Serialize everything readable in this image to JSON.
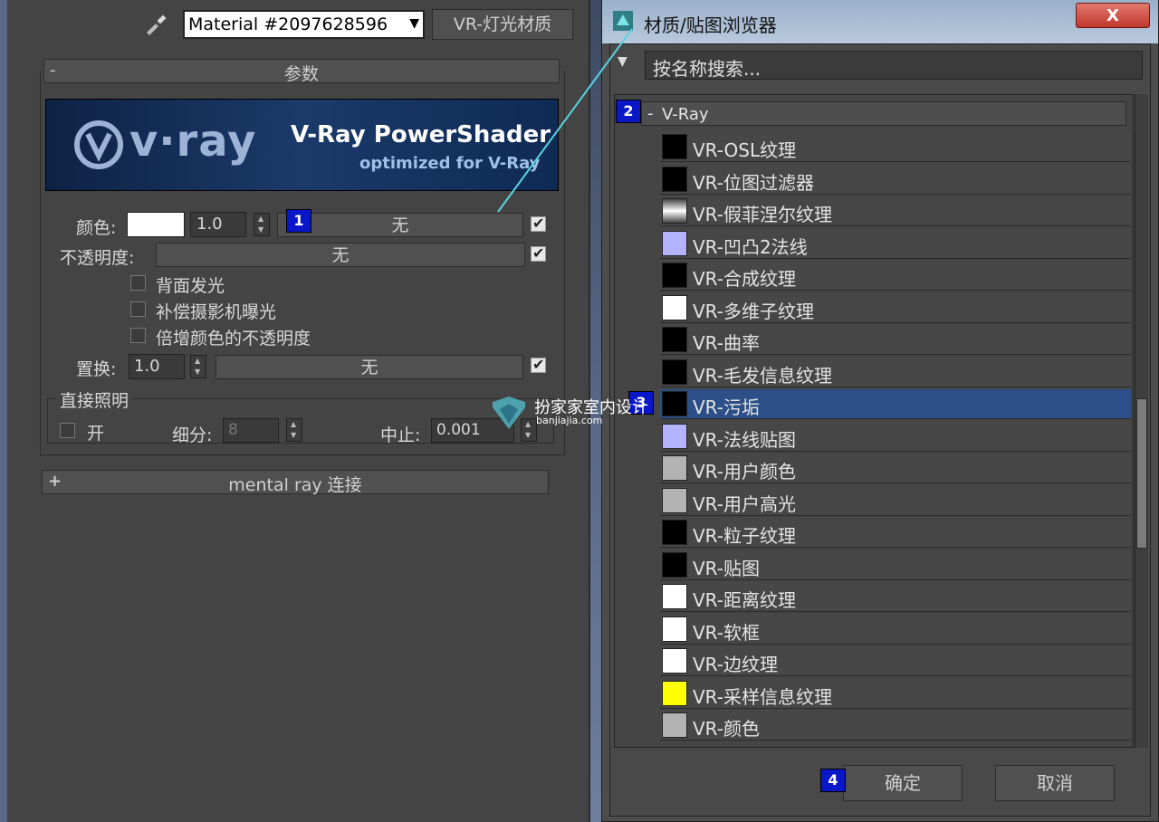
{
  "left": {
    "material_name": "Material #2097628596",
    "material_type": "VR-灯光材质",
    "params_rollout": {
      "toggle": "-",
      "title": "参数"
    },
    "banner": {
      "logo_text": "v·ray",
      "title": "V-Ray PowerShader",
      "subtitle": "optimized for V-Ray"
    },
    "color_row": {
      "label": "颜色:",
      "value": "1.0",
      "map": "无"
    },
    "opacity_row": {
      "label": "不透明度:",
      "map": "无"
    },
    "checkboxes": [
      "背面发光",
      "补偿摄影机曝光",
      "倍增颜色的不透明度"
    ],
    "displace_row": {
      "label": "置换:",
      "value": "1.0",
      "map": "无"
    },
    "direct_group": {
      "title": "直接照明",
      "on_label": "开",
      "subdiv_label": "细分:",
      "subdiv_value": "8",
      "cutoff_label": "中止:",
      "cutoff_value": "0.001"
    },
    "mental_ray": {
      "toggle": "+",
      "title": "mental ray 连接"
    }
  },
  "dialog": {
    "title": "材质/贴图浏览器",
    "close": "X",
    "search_placeholder": "按名称搜索...",
    "group": {
      "toggle": "-",
      "name": "V-Ray"
    },
    "items": [
      {
        "label": "VR-OSL纹理",
        "swatch": "#000000"
      },
      {
        "label": "VR-位图过滤器",
        "swatch": "#000000"
      },
      {
        "label": "VR-假菲涅尔纹理",
        "swatch": "gradient"
      },
      {
        "label": "VR-凹凸2法线",
        "swatch": "#b3b3ff"
      },
      {
        "label": "VR-合成纹理",
        "swatch": "#000000"
      },
      {
        "label": "VR-多维子纹理",
        "swatch": "#ffffff"
      },
      {
        "label": "VR-曲率",
        "swatch": "#000000"
      },
      {
        "label": "VR-毛发信息纹理",
        "swatch": "#000000"
      },
      {
        "label": "VR-污垢",
        "swatch": "#000000",
        "selected": true
      },
      {
        "label": "VR-法线贴图",
        "swatch": "#b3b3ff"
      },
      {
        "label": "VR-用户颜色",
        "swatch": "#b3b3b3"
      },
      {
        "label": "VR-用户高光",
        "swatch": "#b3b3b3"
      },
      {
        "label": "VR-粒子纹理",
        "swatch": "#000000"
      },
      {
        "label": "VR-贴图",
        "swatch": "#000000"
      },
      {
        "label": "VR-距离纹理",
        "swatch": "#ffffff"
      },
      {
        "label": "VR-软框",
        "swatch": "#ffffff"
      },
      {
        "label": "VR-边纹理",
        "swatch": "#ffffff"
      },
      {
        "label": "VR-采样信息纹理",
        "swatch": "#ffff00"
      },
      {
        "label": "VR-颜色",
        "swatch": "#b3b3b3"
      }
    ],
    "ok": "确定",
    "cancel": "取消"
  },
  "badges": [
    "1",
    "2",
    "3",
    "4"
  ],
  "watermark": {
    "name": "扮家家室内设计",
    "url": "banjiajia.com"
  }
}
